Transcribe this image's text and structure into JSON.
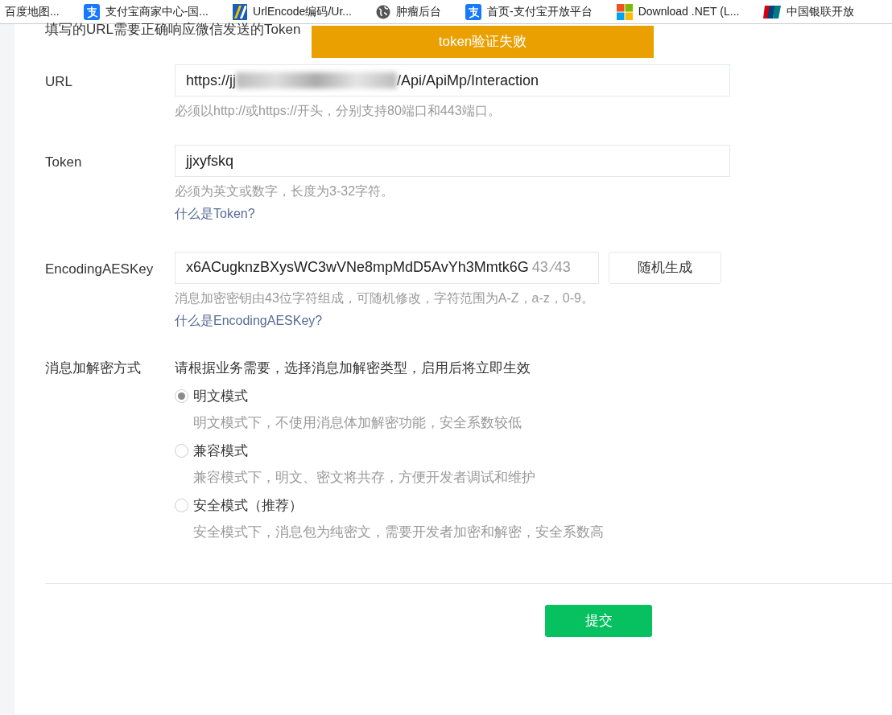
{
  "bookmarks": [
    {
      "label": "百度地图...",
      "kind": "none"
    },
    {
      "label": "支付宝商家中心-国...",
      "kind": "alipay"
    },
    {
      "label": "UrlEncode编码/Ur...",
      "kind": "stripes"
    },
    {
      "label": "肿瘤后台",
      "kind": "globe"
    },
    {
      "label": "首页-支付宝开放平台",
      "kind": "alipay"
    },
    {
      "label": "Download .NET (L...",
      "kind": "windows"
    },
    {
      "label": "中国银联开放",
      "kind": "card"
    }
  ],
  "intro": "填写的URL需要正确响应微信发送的Token",
  "toast": "token验证失败",
  "url": {
    "label": "URL",
    "value_start": "https://jj",
    "value_end": "/Api/ApiMp/Interaction",
    "hint": "必须以http://或https://开头，分别支持80端口和443端口。"
  },
  "token": {
    "label": "Token",
    "value": "jjxyfskq",
    "hint": "必须为英文或数字，长度为3-32字符。",
    "link": "什么是Token?"
  },
  "aes": {
    "label": "EncodingAESKey",
    "value": "x6ACugknzBXysWC3wVNe8mpMdD5AvYh3Mmtk6G",
    "counter": "43 ⁄43",
    "button": "随机生成",
    "hint": "消息加密密钥由43位字符组成，可随机修改，字符范围为A-Z，a-z，0-9。",
    "link": "什么是EncodingAESKey?"
  },
  "mode": {
    "label": "消息加解密方式",
    "intro": "请根据业务需要，选择消息加解密类型，启用后将立即生效",
    "options": [
      {
        "label": "明文模式",
        "desc": "明文模式下，不使用消息体加解密功能，安全系数较低",
        "selected": true
      },
      {
        "label": "兼容模式",
        "desc": "兼容模式下，明文、密文将共存，方便开发者调试和维护",
        "selected": false
      },
      {
        "label": "安全模式（推荐）",
        "desc": "安全模式下，消息包为纯密文，需要开发者加密和解密，安全系数高",
        "selected": false
      }
    ]
  },
  "submit": "提交"
}
